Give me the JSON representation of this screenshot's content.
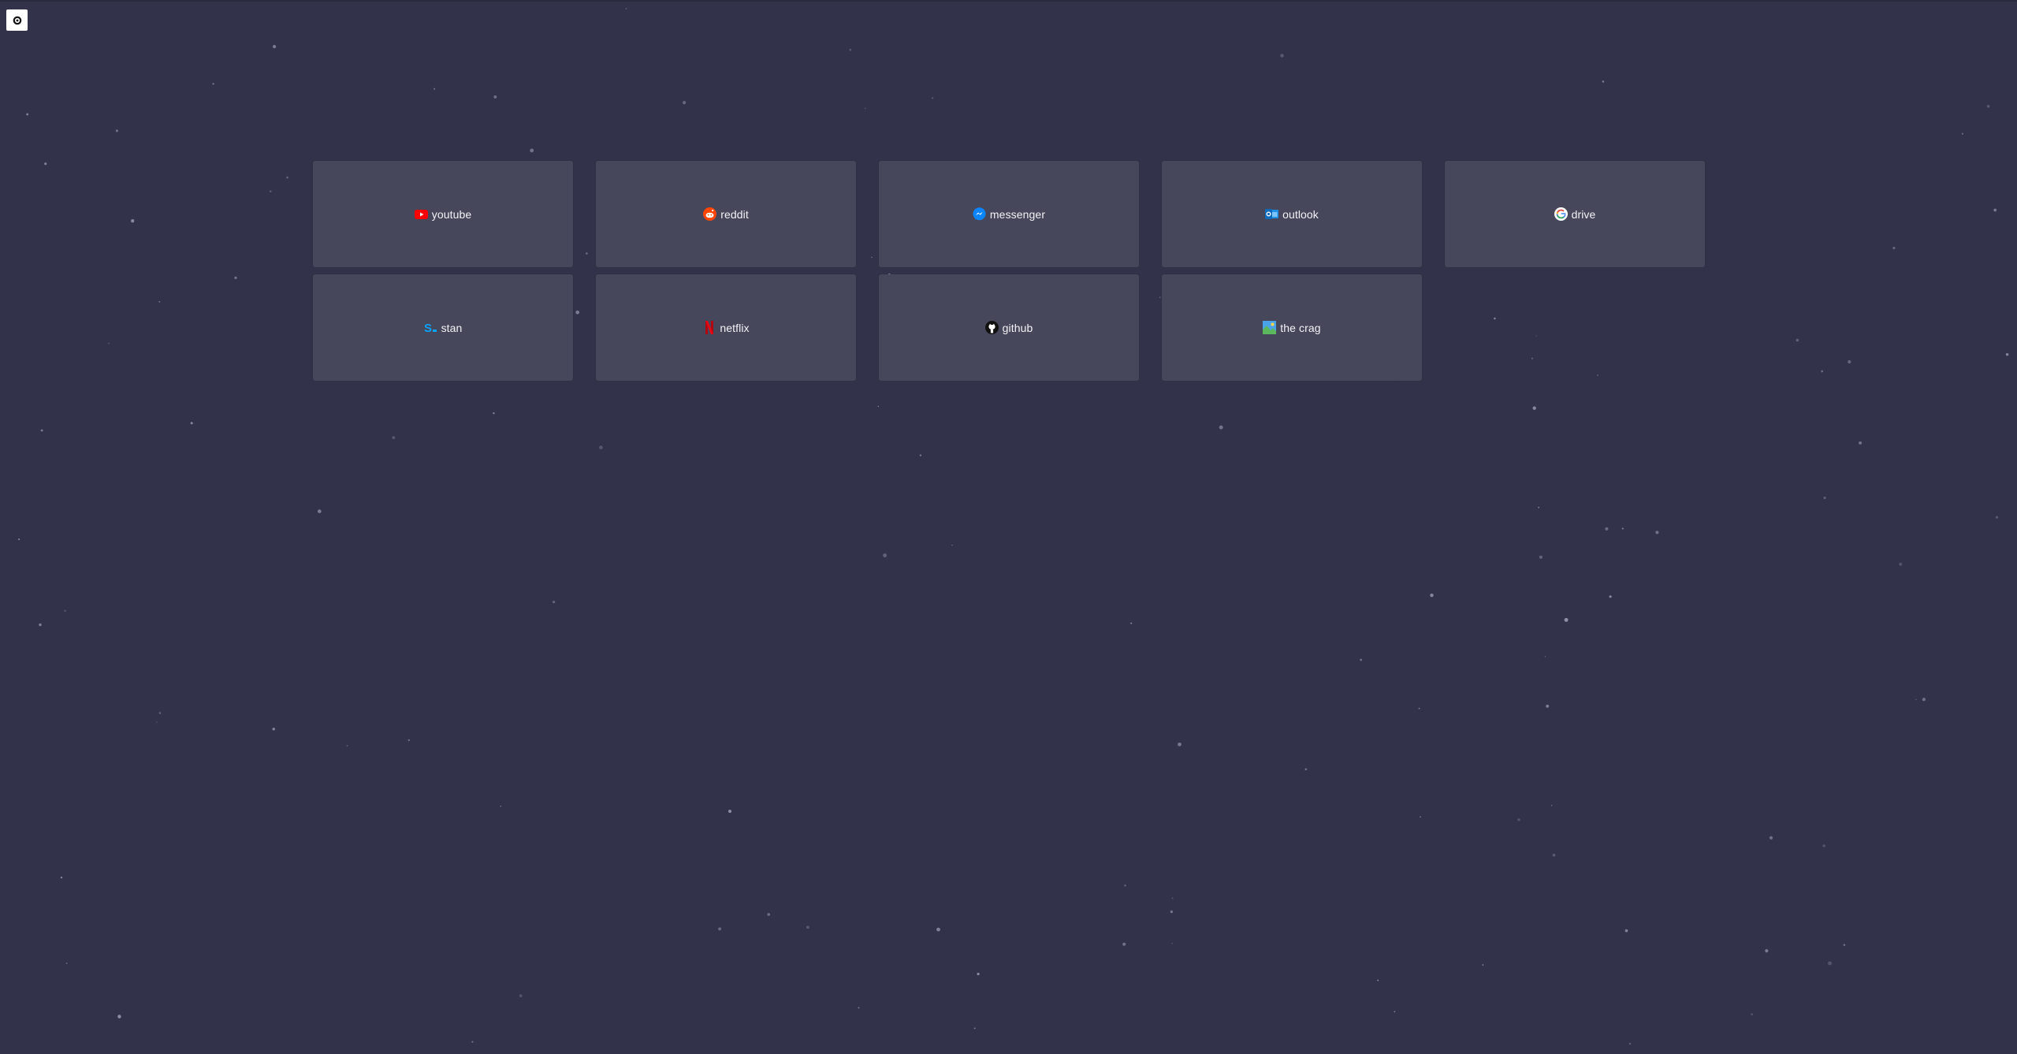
{
  "settings": {
    "icon": "gear-icon"
  },
  "colors": {
    "background": "#32324a",
    "tile": "#47475b",
    "text": "#f2f2f6"
  },
  "tiles": [
    {
      "label": "youtube",
      "icon": "youtube-icon"
    },
    {
      "label": "reddit",
      "icon": "reddit-icon"
    },
    {
      "label": "messenger",
      "icon": "messenger-icon"
    },
    {
      "label": "outlook",
      "icon": "outlook-icon"
    },
    {
      "label": "drive",
      "icon": "google-icon"
    },
    {
      "label": "stan",
      "icon": "stan-icon"
    },
    {
      "label": "netflix",
      "icon": "netflix-icon"
    },
    {
      "label": "github",
      "icon": "github-icon"
    },
    {
      "label": "the crag",
      "icon": "image-icon"
    }
  ]
}
